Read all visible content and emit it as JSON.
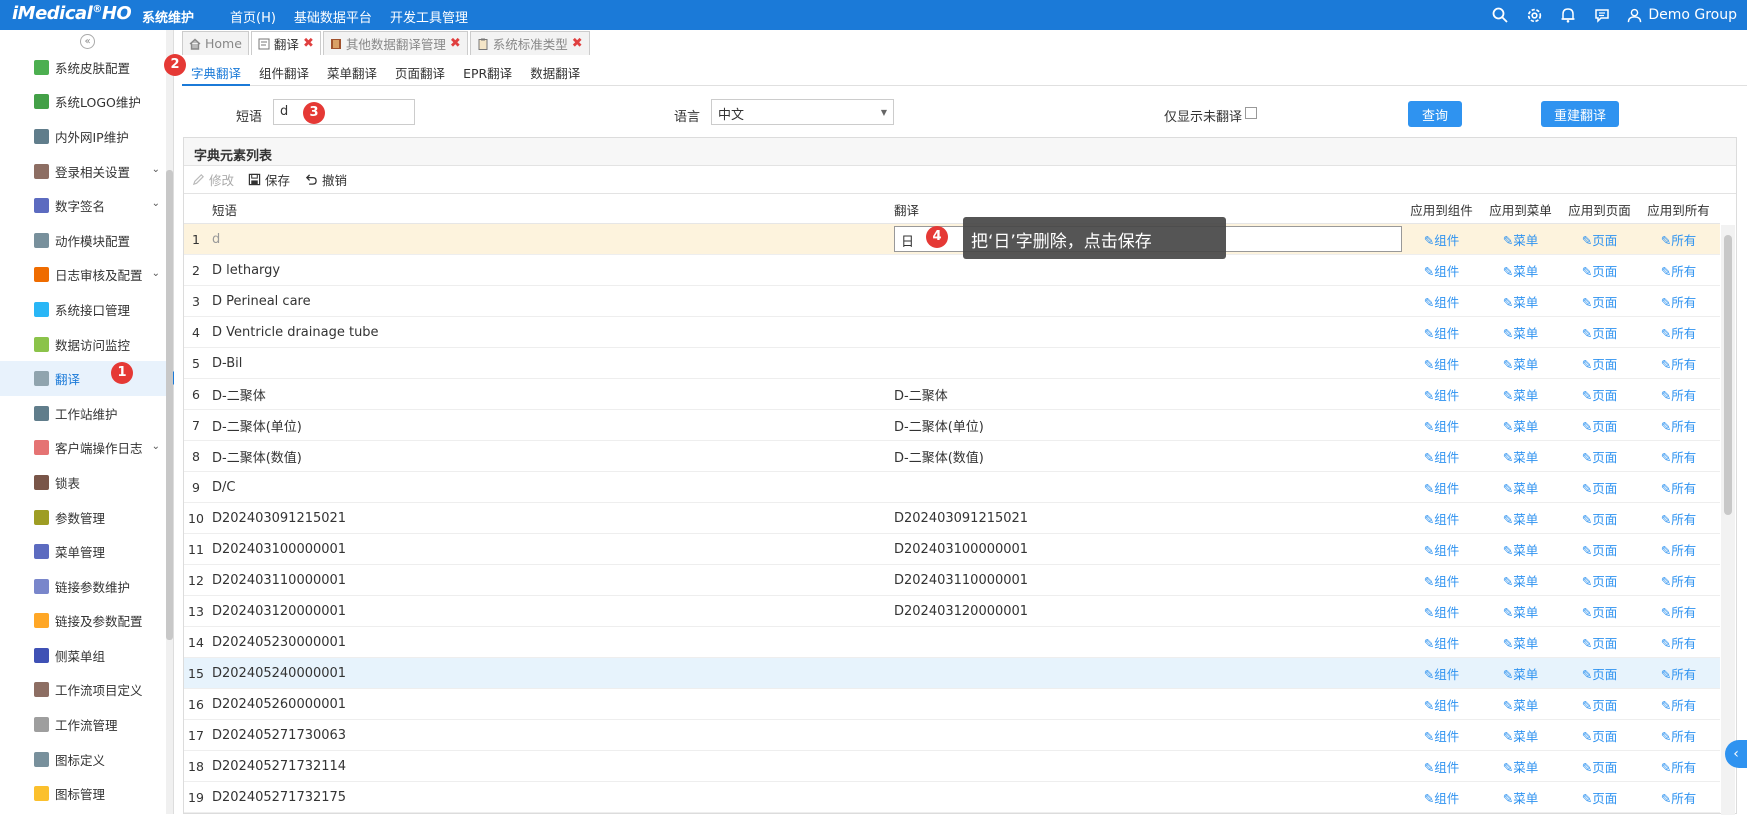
{
  "header": {
    "brand": "iMedical",
    "brand_suffix": "HO",
    "system_name": "系统维护",
    "nav": [
      "首页(H)",
      "基础数据平台",
      "开发工具管理"
    ],
    "user": "Demo Group"
  },
  "sidebar": {
    "items": [
      {
        "label": "系统皮肤配置",
        "icon": "palette-icon",
        "chev": false
      },
      {
        "label": "系统LOGO维护",
        "icon": "puzzle-icon",
        "chev": false
      },
      {
        "label": "内外网IP维护",
        "icon": "network-icon",
        "chev": false
      },
      {
        "label": "登录相关设置",
        "icon": "users-icon",
        "chev": true
      },
      {
        "label": "数字签名",
        "icon": "signature-icon",
        "chev": true
      },
      {
        "label": "动作模块配置",
        "icon": "module-icon",
        "chev": false
      },
      {
        "label": "日志审核及配置",
        "icon": "log-icon",
        "chev": true
      },
      {
        "label": "系统接口管理",
        "icon": "interface-icon",
        "chev": false
      },
      {
        "label": "数据访问监控",
        "icon": "monitor-icon",
        "chev": false
      },
      {
        "label": "翻译",
        "icon": "translate-icon",
        "chev": false
      },
      {
        "label": "工作站维护",
        "icon": "workstation-icon",
        "chev": false
      },
      {
        "label": "客户端操作日志",
        "icon": "client-log-icon",
        "chev": true
      },
      {
        "label": "锁表",
        "icon": "tools-icon",
        "chev": false
      },
      {
        "label": "参数管理",
        "icon": "params-icon",
        "chev": false
      },
      {
        "label": "菜单管理",
        "icon": "menu-icon",
        "chev": false
      },
      {
        "label": "链接参数维护",
        "icon": "link-icon",
        "chev": false
      },
      {
        "label": "链接及参数配置",
        "icon": "home-link-icon",
        "chev": false
      },
      {
        "label": "侧菜单组",
        "icon": "side-menu-icon",
        "chev": false
      },
      {
        "label": "工作流项目定义",
        "icon": "workflow-def-icon",
        "chev": false
      },
      {
        "label": "工作流管理",
        "icon": "workflow-icon",
        "chev": false
      },
      {
        "label": "图标定义",
        "icon": "icon-def-icon",
        "chev": false
      },
      {
        "label": "图标管理",
        "icon": "icon-manage-icon",
        "chev": false
      }
    ],
    "active_index": 9
  },
  "tabs": [
    {
      "label": "Home",
      "closable": false
    },
    {
      "label": "翻译",
      "closable": true
    },
    {
      "label": "其他数据翻译管理",
      "closable": true
    },
    {
      "label": "系统标准类型",
      "closable": true
    }
  ],
  "subtabs": [
    "字典翻译",
    "组件翻译",
    "菜单翻译",
    "页面翻译",
    "EPR翻译",
    "数据翻译"
  ],
  "filters": {
    "phrase_label": "短语",
    "phrase_value": "d",
    "lang_label": "语言",
    "lang_value": "中文",
    "untranslated_label": "仅显示未翻译",
    "query_button": "查询",
    "rebuild_button": "重建翻译"
  },
  "panel": {
    "title": "字典元素列表",
    "toolbar": {
      "edit": "修改",
      "save": "保存",
      "undo": "撤销"
    },
    "columns": {
      "phrase": "短语",
      "translation": "翻译",
      "apply_component": "应用到组件",
      "apply_menu": "应用到菜单",
      "apply_page": "应用到页面",
      "apply_all": "应用到所有"
    },
    "actions": {
      "component": "组件",
      "menu": "菜单",
      "page": "页面",
      "all": "所有"
    },
    "rows": [
      {
        "num": "1",
        "phrase": "d",
        "translation": "日"
      },
      {
        "num": "2",
        "phrase": "D lethargy",
        "translation": ""
      },
      {
        "num": "3",
        "phrase": "D Perineal care",
        "translation": ""
      },
      {
        "num": "4",
        "phrase": "D Ventricle drainage tube",
        "translation": ""
      },
      {
        "num": "5",
        "phrase": "D-Bil",
        "translation": ""
      },
      {
        "num": "6",
        "phrase": "D-二聚体",
        "translation": "D-二聚体"
      },
      {
        "num": "7",
        "phrase": "D-二聚体(单位)",
        "translation": "D-二聚体(单位)"
      },
      {
        "num": "8",
        "phrase": "D-二聚体(数值)",
        "translation": "D-二聚体(数值)"
      },
      {
        "num": "9",
        "phrase": "D/C",
        "translation": ""
      },
      {
        "num": "10",
        "phrase": "D202403091215021",
        "translation": "D202403091215021"
      },
      {
        "num": "11",
        "phrase": "D202403100000001",
        "translation": "D202403100000001"
      },
      {
        "num": "12",
        "phrase": "D202403110000001",
        "translation": "D202403110000001"
      },
      {
        "num": "13",
        "phrase": "D202403120000001",
        "translation": "D202403120000001"
      },
      {
        "num": "14",
        "phrase": "D202405230000001",
        "translation": ""
      },
      {
        "num": "15",
        "phrase": "D202405240000001",
        "translation": ""
      },
      {
        "num": "16",
        "phrase": "D202405260000001",
        "translation": ""
      },
      {
        "num": "17",
        "phrase": "D202405271730063",
        "translation": ""
      },
      {
        "num": "18",
        "phrase": "D202405271732114",
        "translation": ""
      },
      {
        "num": "19",
        "phrase": "D202405271732175",
        "translation": ""
      }
    ]
  },
  "annotations": {
    "steps": [
      "1",
      "2",
      "3",
      "4"
    ],
    "tooltip": "把‘日’字删除，点击保存"
  },
  "colors": {
    "primary": "#1b7ad8",
    "button": "#2f93f0",
    "badge": "#e53935",
    "selected_row": "#fdf3dd"
  }
}
